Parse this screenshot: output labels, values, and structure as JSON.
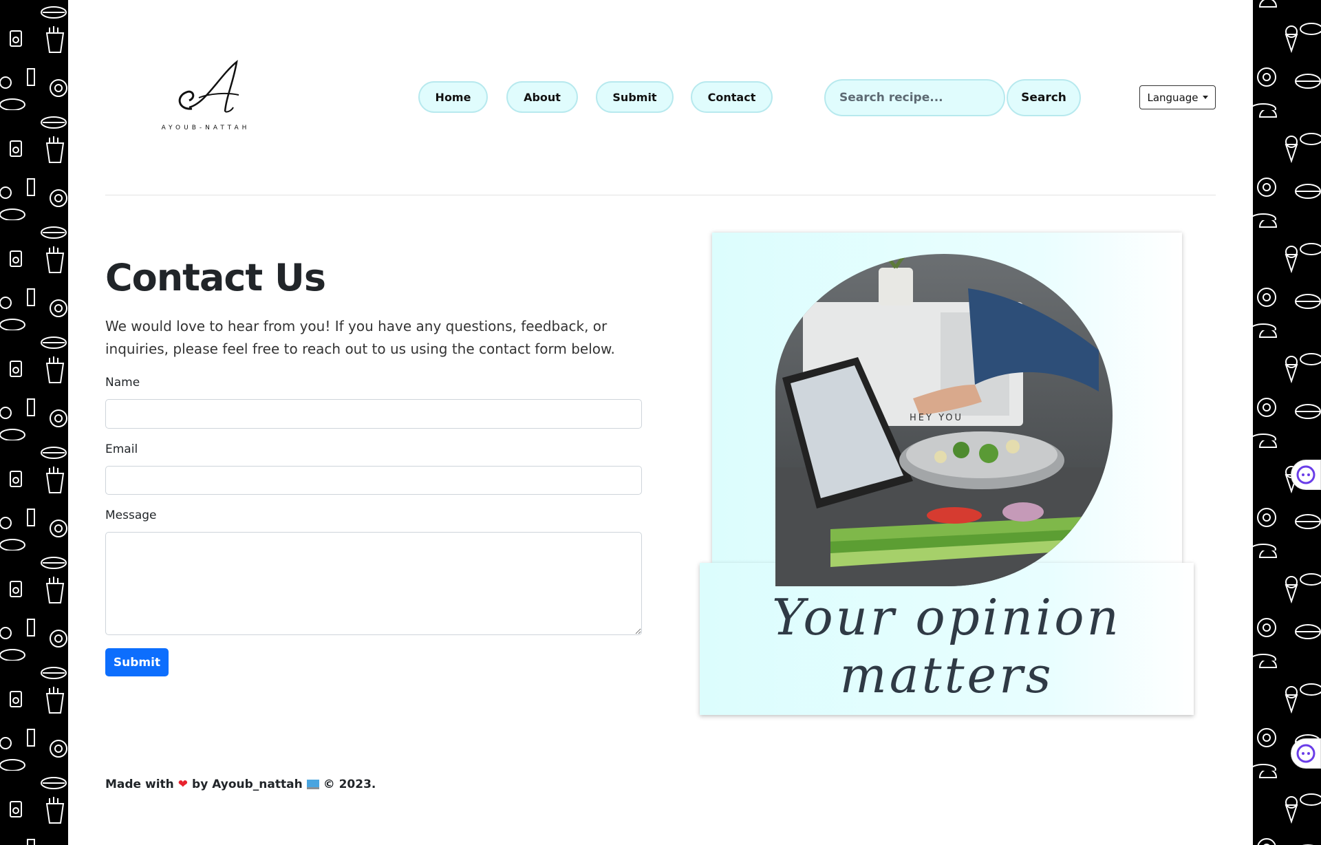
{
  "logo": {
    "initial": "A",
    "text": "AYOUB-NATTAH"
  },
  "nav": {
    "home": "Home",
    "about": "About",
    "submit": "Submit",
    "contact": "Contact"
  },
  "search": {
    "placeholder": "Search recipe...",
    "button": "Search"
  },
  "language": {
    "label": "Language"
  },
  "contact": {
    "heading": "Contact Us",
    "intro": "We would love to hear from you! If you have any questions, feedback, or inquiries, please feel free to reach out to us using the contact form below.",
    "name_label": "Name",
    "email_label": "Email",
    "message_label": "Message",
    "submit_label": "Submit"
  },
  "card": {
    "caption": "Your opinion matters",
    "photo_overlay": "HEY YOU"
  },
  "footer": {
    "made_with": "Made with",
    "by": "by Ayoub_nattah",
    "year": "© 2023."
  },
  "colors": {
    "pill_bg": "#e0fcfd",
    "pill_border": "#b7e9ee",
    "primary": "#0d6efd",
    "side_bg": "#000000"
  },
  "icons": [
    "heart-icon",
    "laptop-icon",
    "chatbot-icon",
    "caret-down-icon"
  ]
}
